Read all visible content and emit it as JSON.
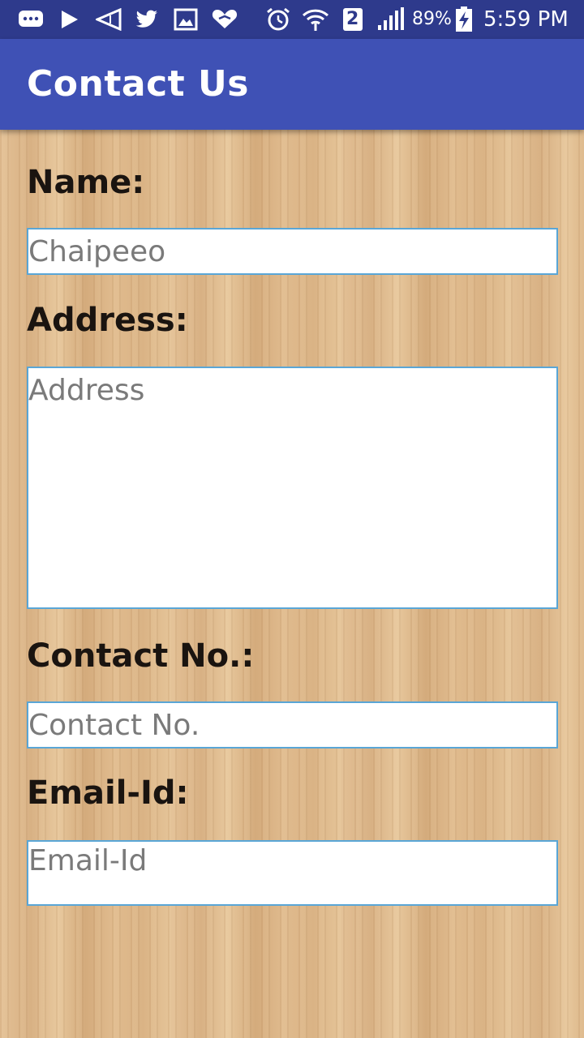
{
  "status_bar": {
    "battery_percent": "89%",
    "time": "5:59 PM",
    "sim_label": "2",
    "icons": [
      "chat-icon",
      "play-icon",
      "vibrate-icon",
      "twitter-icon",
      "image-icon",
      "heart-chat-icon",
      "alarm-icon",
      "wifi-icon",
      "signal-icon",
      "battery-charging-icon"
    ]
  },
  "app_bar": {
    "title": "Contact Us",
    "color": "#3f51b5"
  },
  "form": {
    "name_label": "Name:",
    "name_placeholder": "Chaipeeo",
    "address_label": "Address:",
    "address_placeholder": "Address",
    "contact_label": "Contact No.:",
    "contact_placeholder": "Contact No.",
    "email_label": "Email-Id:",
    "email_placeholder": "Email-Id"
  },
  "colors": {
    "status_bar": "#2e3a8c",
    "field_border": "#5aa6d6",
    "background_wood": "#dcb58a"
  }
}
